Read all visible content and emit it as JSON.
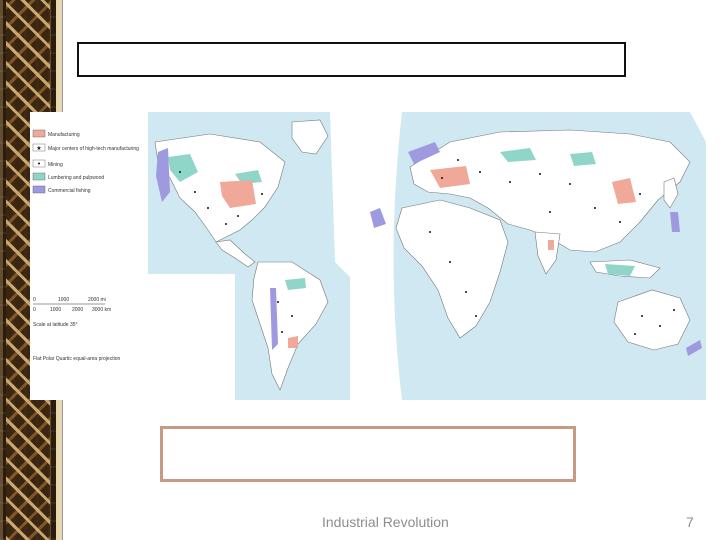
{
  "slide": {
    "footer": "Industrial Revolution",
    "page_number": "7"
  },
  "map": {
    "legend": [
      {
        "label": "Manufacturing",
        "color": "#f0a898"
      },
      {
        "label": "Major centers of high-tech manufacturing",
        "color": "#ffffff"
      },
      {
        "label": "Mining",
        "color": "#ffffff"
      },
      {
        "label": "Lumbering and pulpwood",
        "color": "#8fd6c9"
      },
      {
        "label": "Commercial fishing",
        "color": "#9f9ae0"
      }
    ],
    "scale_bar": {
      "miles": [
        "0",
        "1000",
        "2000 mi"
      ],
      "km": [
        "0",
        "1000",
        "2000",
        "3000 km"
      ],
      "note": "Scale at latitude 35°"
    },
    "projection": "Flat Polar Quartic equal-area projection",
    "ocean_color": "#cfe8f2",
    "land_color": "#ffffff"
  }
}
